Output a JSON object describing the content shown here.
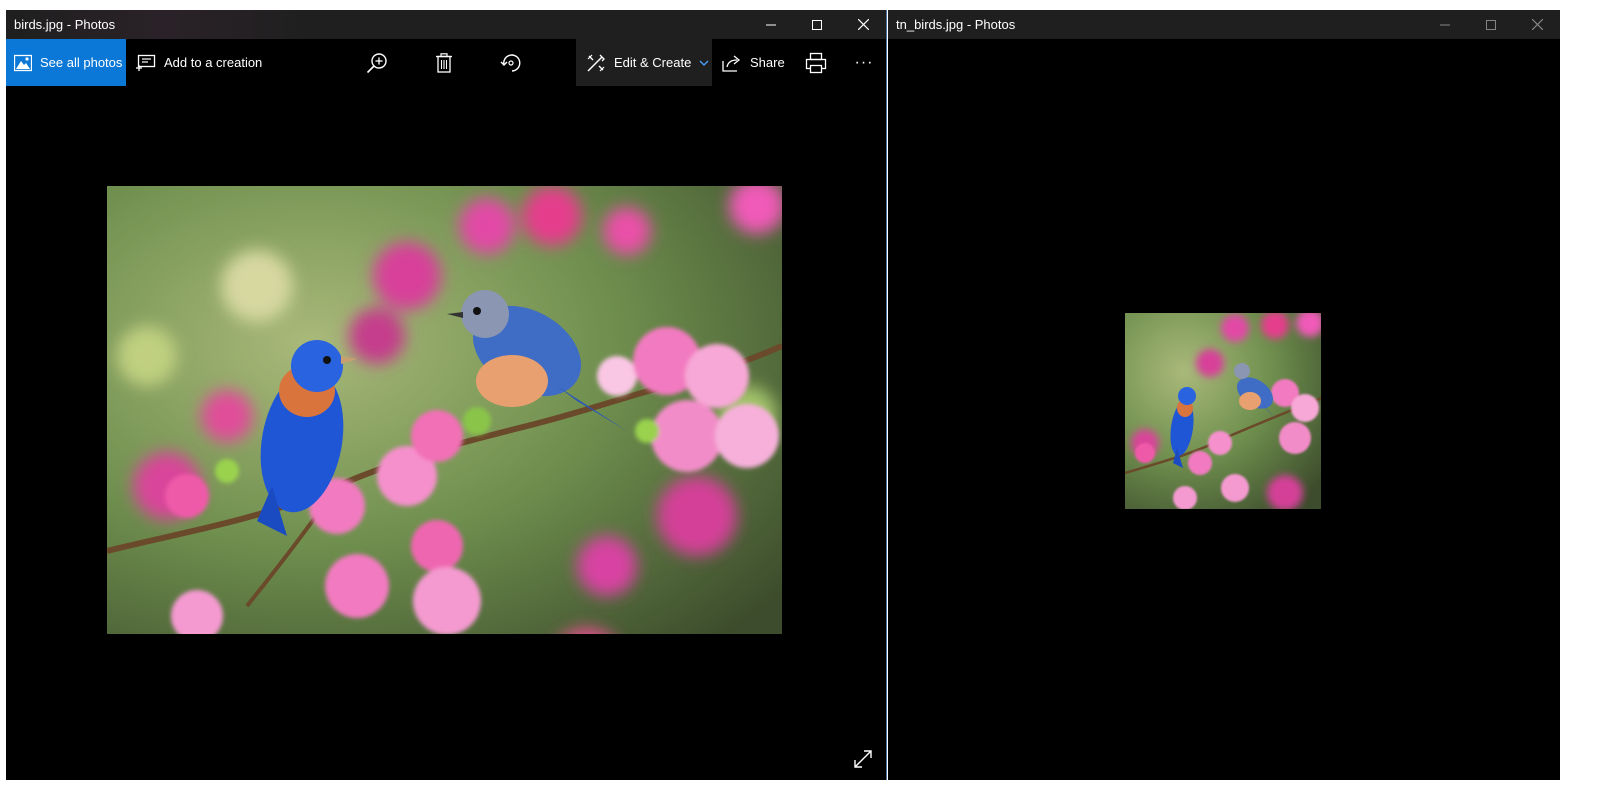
{
  "left_window": {
    "title": "birds.jpg - Photos",
    "toolbar": {
      "see_all_photos": "See all photos",
      "add_to_creation": "Add to a creation",
      "edit_create": "Edit & Create",
      "share": "Share",
      "more": "···"
    },
    "accent_color": "#0b78d7"
  },
  "right_window": {
    "title": "tn_birds.jpg - Photos"
  }
}
